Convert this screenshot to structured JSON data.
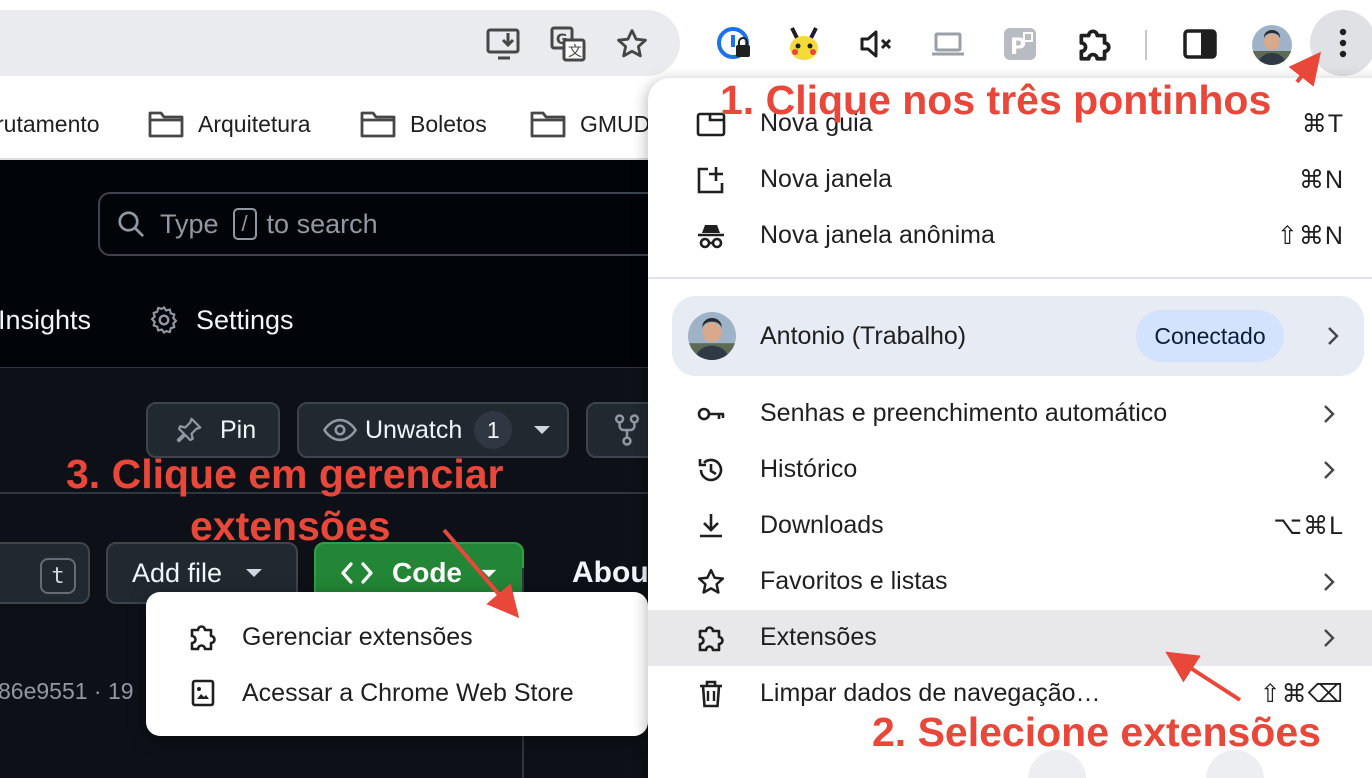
{
  "bookmarks": [
    {
      "label": "rutamento",
      "icon": "none"
    },
    {
      "label": "Arquitetura",
      "icon": "folder-icon"
    },
    {
      "label": "Boletos",
      "icon": "folder-icon"
    },
    {
      "label": "GMUD",
      "icon": "folder-icon"
    }
  ],
  "github": {
    "search_prefix": "Type",
    "search_key": "/",
    "search_suffix": "to search",
    "nav_insights": "Insights",
    "nav_settings": "Settings",
    "pin_label": "Pin",
    "unwatch_label": "Unwatch",
    "unwatch_count": "1",
    "go_to_file_key": "t",
    "add_file_label": "Add file",
    "code_label": "Code",
    "about_label": "About",
    "commit_hash": "86e9551 · 19"
  },
  "extensions_popup": {
    "manage_label": "Gerenciar extensões",
    "webstore_label": "Acessar a Chrome Web Store"
  },
  "menu": {
    "items_top": [
      {
        "label": "Nova guia",
        "shortcut": "⌘T",
        "icon": "new-tab-icon"
      },
      {
        "label": "Nova janela",
        "shortcut": "⌘N",
        "icon": "new-window-icon"
      },
      {
        "label": "Nova janela anônima",
        "shortcut": "⇧⌘N",
        "icon": "incognito-icon"
      }
    ],
    "profile": {
      "name": "Antonio (Trabalho)",
      "status": "Conectado"
    },
    "items": [
      {
        "label": "Senhas e preenchimento automático",
        "icon": "key-icon"
      },
      {
        "label": "Histórico",
        "icon": "history-icon"
      },
      {
        "label": "Downloads",
        "shortcut": "⌥⌘L",
        "icon": "download-icon"
      },
      {
        "label": "Favoritos e listas",
        "icon": "star-icon"
      },
      {
        "label": "Extensões",
        "icon": "extension-icon",
        "highlighted": true
      },
      {
        "label": "Limpar dados de navegação…",
        "shortcut": "⇧⌘⌫",
        "icon": "trash-icon"
      }
    ]
  },
  "annotations": {
    "step1": "1. Clique nos três pontinhos",
    "step2": "2. Selecione extensões",
    "step3_line1": "3. Clique em gerenciar",
    "step3_line2": "extensões"
  },
  "colors": {
    "annotation": "#e8473a",
    "menu_highlight": "#e8e8ea",
    "badge": "#d3e3fd",
    "github_bg": "#0d1117",
    "code_button": "#238636"
  }
}
